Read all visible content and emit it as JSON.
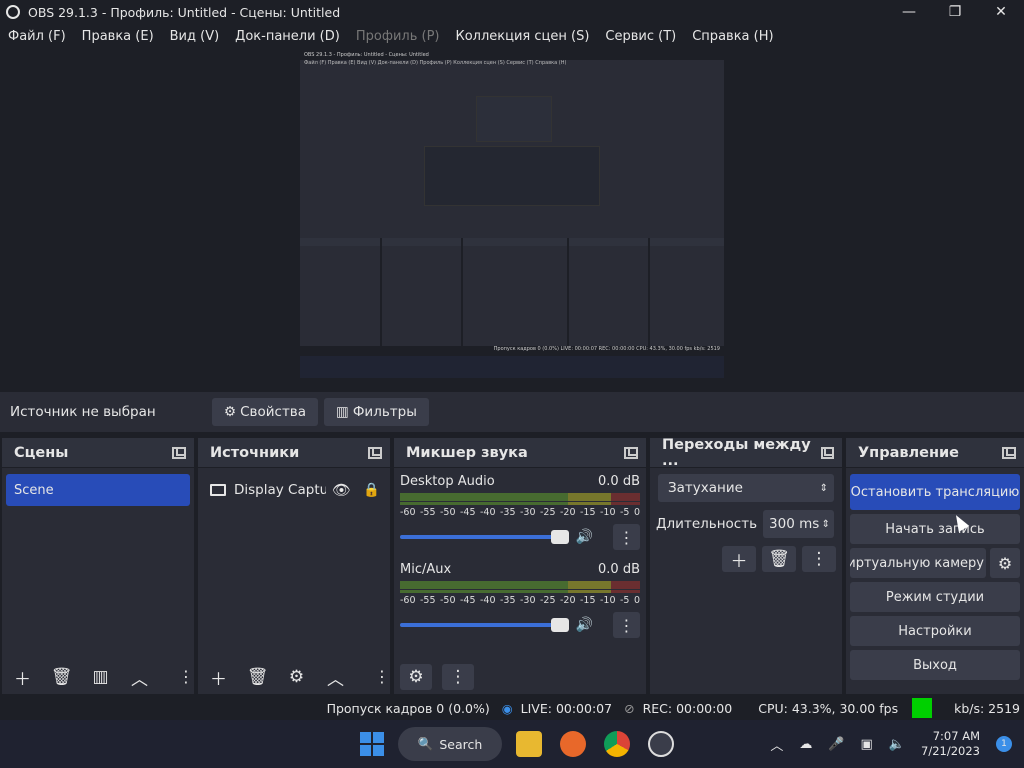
{
  "window": {
    "title": "OBS 29.1.3 - Профиль: Untitled - Сцены: Untitled",
    "min": "—",
    "max": "❐",
    "close": "✕"
  },
  "menu": [
    "Файл (F)",
    "Правка (E)",
    "Вид (V)",
    "Док-панели (D)",
    "Профиль (P)",
    "Коллекция сцен (S)",
    "Сервис (T)",
    "Справка (H)"
  ],
  "preview": {
    "mini_title": "OBS 29.1.3 - Профиль: Untitled - Сцены: Untitled",
    "mini_menu": "Файл (F)  Правка (E)  Вид (V)  Док-панели (D)  Профиль (P)  Коллекция сцен (S)  Сервис (T)  Справка (H)",
    "mini_status": "Пропуск кадров 0 (0.0%)  LIVE: 00:00:07  REC: 00:00:00  CPU: 43.3%, 30.00 fps  kb/s: 2519"
  },
  "sourcebar": {
    "label": "Источник не выбран",
    "properties": "Свойства",
    "filters": "Фильтры"
  },
  "scenes": {
    "title": "Сцены",
    "items": [
      "Scene"
    ]
  },
  "sources": {
    "title": "Источники",
    "items": [
      "Display Capture"
    ]
  },
  "mixer": {
    "title": "Микшер звука",
    "scale": [
      "-60",
      "-55",
      "-50",
      "-45",
      "-40",
      "-35",
      "-30",
      "-25",
      "-20",
      "-15",
      "-10",
      "-5",
      "0"
    ],
    "channels": [
      {
        "name": "Desktop Audio",
        "level": "0.0 dB",
        "volume": 0.95
      },
      {
        "name": "Mic/Aux",
        "level": "0.0 dB",
        "volume": 0.95
      }
    ]
  },
  "transitions": {
    "title": "Переходы между ...",
    "selected": "Затухание",
    "duration_label": "Длительность",
    "duration": "300 ms"
  },
  "controls": {
    "title": "Управление",
    "stop_stream": "Остановить трансляцию",
    "start_record": "Начать запись",
    "virtual_cam": "Запустить виртуальную камеру",
    "studio_mode": "Режим студии",
    "settings": "Настройки",
    "exit": "Выход"
  },
  "status": {
    "dropped": "Пропуск кадров 0 (0.0%)",
    "live": "LIVE: 00:00:07",
    "rec": "REC: 00:00:00",
    "cpu": "CPU: 43.3%, 30.00 fps",
    "kbps": "kb/s: 2519",
    "indicator_color": "#00d000"
  },
  "taskbar": {
    "search": "Search",
    "time": "7:07 AM",
    "date": "7/21/2023",
    "badge": "1"
  }
}
